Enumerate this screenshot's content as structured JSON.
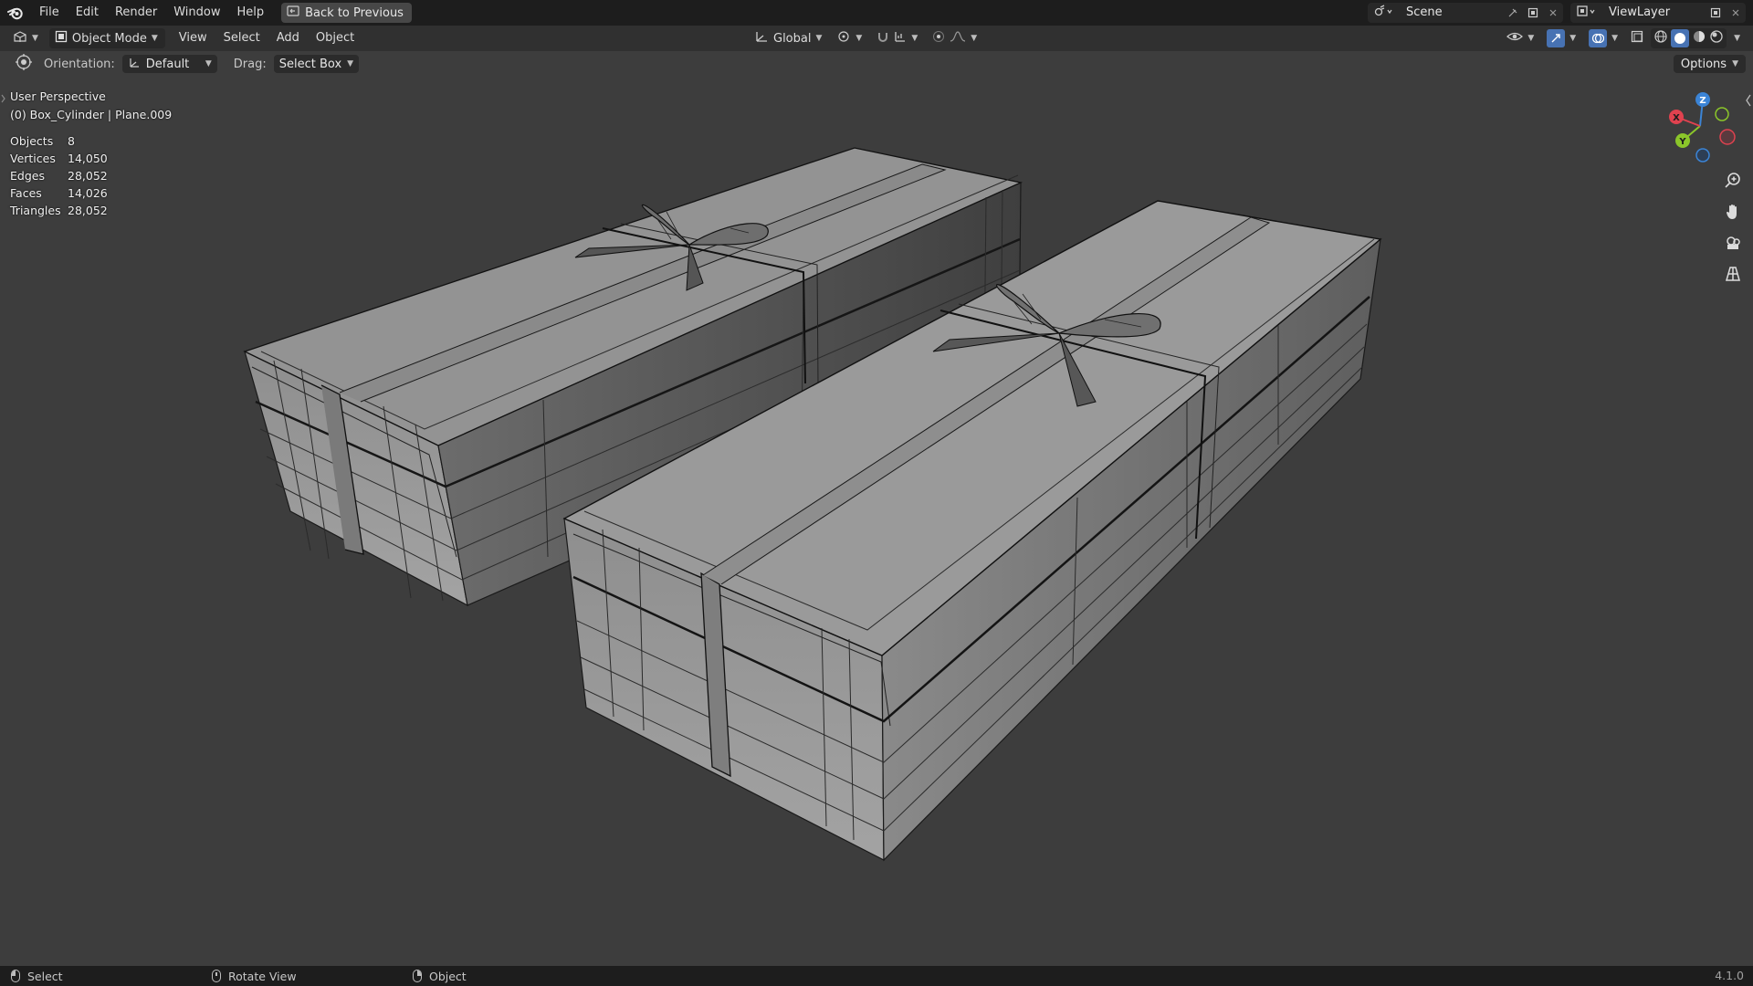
{
  "menu": {
    "items": [
      "File",
      "Edit",
      "Render",
      "Window",
      "Help"
    ],
    "back_button": "Back to Previous"
  },
  "workspace": {
    "scene_name": "Scene",
    "view_layer_name": "ViewLayer"
  },
  "header": {
    "mode": "Object Mode",
    "menus": [
      "View",
      "Select",
      "Add",
      "Object"
    ],
    "transform_orientation": "Global"
  },
  "tool_settings": {
    "orientation_label": "Orientation:",
    "orientation_value": "Default",
    "drag_label": "Drag:",
    "drag_value": "Select Box",
    "options_label": "Options"
  },
  "viewport": {
    "view_name": "User Perspective",
    "active_object": "(0) Box_Cylinder | Plane.009",
    "stats": [
      {
        "label": "Objects",
        "value": "8"
      },
      {
        "label": "Vertices",
        "value": "14,050"
      },
      {
        "label": "Edges",
        "value": "28,052"
      },
      {
        "label": "Faces",
        "value": "14,026"
      },
      {
        "label": "Triangles",
        "value": "28,052"
      }
    ],
    "gizmo_axes": {
      "x": "X",
      "y": "Y",
      "z": "Z"
    },
    "colors": {
      "x_axis": "#e0424f",
      "y_axis": "#8bc62a",
      "z_axis": "#3b84d6",
      "background": "#3d3d3d"
    }
  },
  "statusbar": {
    "items": [
      {
        "label": "Select",
        "mouse": "left"
      },
      {
        "label": "Rotate View",
        "mouse": "middle"
      },
      {
        "label": "Object",
        "mouse": "right"
      }
    ],
    "version": "4.1.0"
  }
}
